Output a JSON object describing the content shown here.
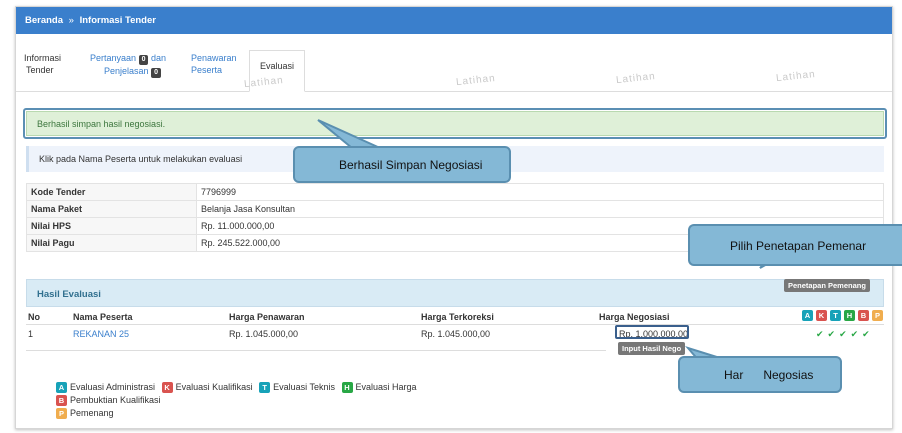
{
  "breadcrumb": {
    "home": "Beranda",
    "separator": "»",
    "current": "Informasi Tender"
  },
  "tabs": [
    {
      "line1": "Informasi",
      "line2": "Tender"
    },
    {
      "line1": "Pertanyaan",
      "badge1": "0",
      "line1b": "dan",
      "line2": "Penjelasan",
      "badge2": "0"
    },
    {
      "line1": "Penawaran",
      "line2": "Peserta"
    },
    {
      "label": "Evaluasi"
    }
  ],
  "watermark": "Latihan",
  "alert": {
    "message": "Berhasil simpan hasil negosiasi."
  },
  "info": {
    "message": "Klik pada Nama Peserta untuk melakukan evaluasi"
  },
  "details": [
    {
      "key": "Kode Tender",
      "value": "7796999"
    },
    {
      "key": "Nama Paket",
      "value": "Belanja Jasa Konsultan"
    },
    {
      "key": "Nilai HPS",
      "value": "Rp. 11.000.000,00"
    },
    {
      "key": "Nilai Pagu",
      "value": "Rp. 245.522.000,00"
    }
  ],
  "evaluation": {
    "title": "Hasil Evaluasi",
    "penetapan_button": "Penetapan Pemenang",
    "headers": {
      "no": "No",
      "nama": "Nama Peserta",
      "penawaran": "Harga Penawaran",
      "terkoreksi": "Harga Terkoreksi",
      "negosiasi": "Harga Negosiasi"
    },
    "status_codes": [
      "A",
      "K",
      "T",
      "H",
      "B",
      "P"
    ],
    "rows": [
      {
        "no": "1",
        "nama": "REKANAN 25",
        "penawaran": "Rp. 1.045.000,00",
        "terkoreksi": "Rp. 1.045.000,00",
        "negosiasi": "Rp. 1.000.000,00",
        "checks": "✔✔✔✔✔"
      }
    ],
    "input_nego_button": "Input Hasil Nego"
  },
  "legend": [
    {
      "code": "A",
      "label": "Evaluasi Administrasi"
    },
    {
      "code": "K",
      "label": "Evaluasi Kualifikasi"
    },
    {
      "code": "T",
      "label": "Evaluasi Teknis"
    },
    {
      "code": "H",
      "label": "Evaluasi Harga"
    },
    {
      "code": "B",
      "label": "Pembuktian Kualifikasi"
    },
    {
      "code": "P",
      "label": "Pemenang"
    }
  ],
  "callouts": {
    "simpan": "Berhasil Simpan Negosiasi",
    "penetapan": "Pilih Penetapan Pemenar",
    "harga": "Har      Negosias"
  }
}
